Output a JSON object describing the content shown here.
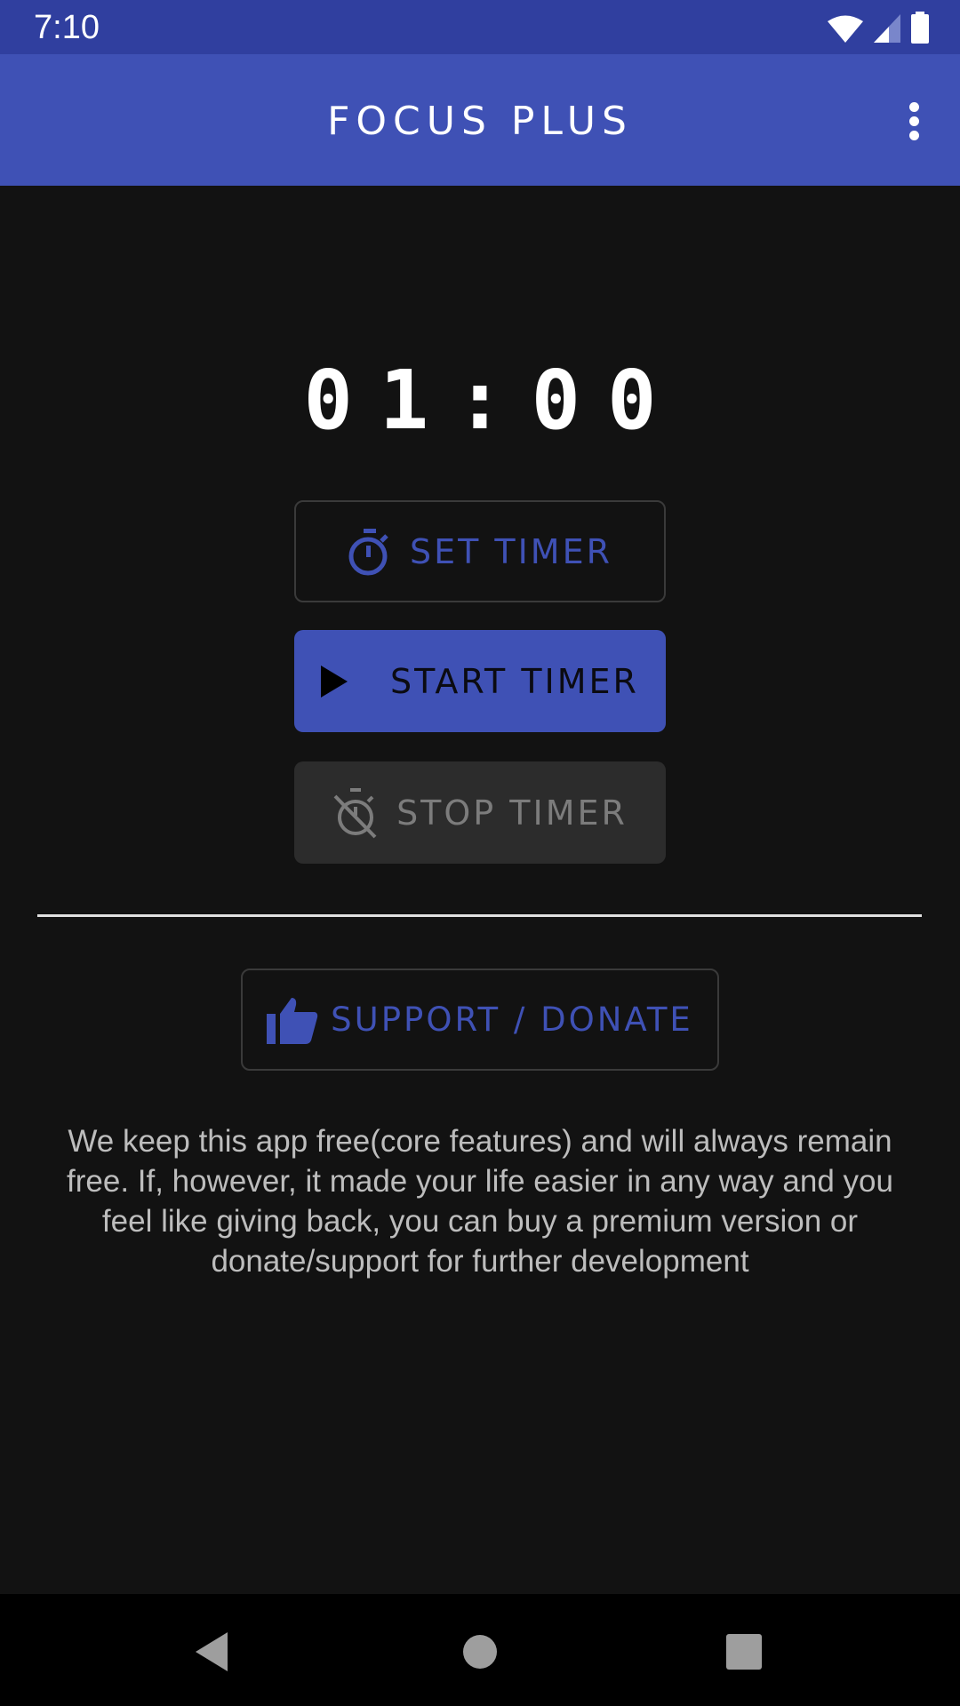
{
  "status_bar": {
    "time": "7:10",
    "icons": [
      "wifi-icon",
      "cellular-signal-icon",
      "battery-icon"
    ]
  },
  "app_bar": {
    "title": "FOCUS PLUS",
    "overflow_icon": "more-vert-icon"
  },
  "timer": {
    "display": "01:00"
  },
  "buttons": {
    "set_timer": {
      "label": "SET TIMER",
      "icon": "timer-icon"
    },
    "start_timer": {
      "label": "START TIMER",
      "icon": "play-icon"
    },
    "stop_timer": {
      "label": "STOP TIMER",
      "icon": "timer-off-icon",
      "disabled": true
    },
    "support": {
      "label": "SUPPORT / DONATE",
      "icon": "thumb-up-icon"
    }
  },
  "support_message": "We keep this app free(core features) and will always remain free. If, however, it made your life easier in any way and you feel like giving back, you can buy a premium version or donate/support for further development",
  "nav_bar": {
    "items": [
      "back-icon",
      "home-icon",
      "recents-icon"
    ]
  },
  "colors": {
    "primary": "#3F51B5",
    "primary_dark": "#303F9F",
    "background": "#121212",
    "disabled_text": "#7c7c7c"
  }
}
